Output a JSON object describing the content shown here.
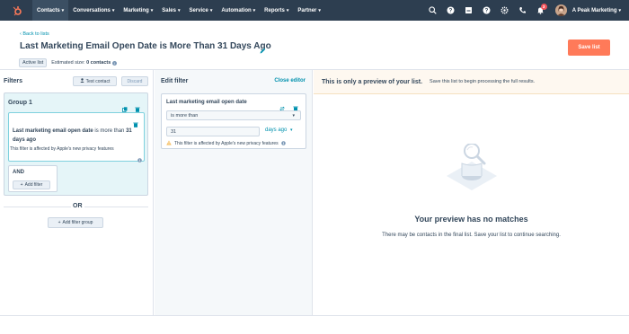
{
  "nav": {
    "items": [
      {
        "label": "Contacts",
        "active": true
      },
      {
        "label": "Conversations",
        "active": false
      },
      {
        "label": "Marketing",
        "active": false
      },
      {
        "label": "Sales",
        "active": false
      },
      {
        "label": "Service",
        "active": false
      },
      {
        "label": "Automation",
        "active": false
      },
      {
        "label": "Reports",
        "active": false
      },
      {
        "label": "Partner",
        "active": false
      }
    ],
    "notification_count": "3",
    "portal_name": "A Peak Marketing"
  },
  "header": {
    "back_link": "Back to lists",
    "title": "Last Marketing Email Open Date is More Than 31 Days Ago",
    "save_label": "Save list",
    "status_pill": "Active list",
    "estimated_prefix": "Estimated size:",
    "estimated_value": "0 contacts"
  },
  "filters_panel": {
    "title": "Filters",
    "test_contact": "Test contact",
    "discard": "Discard",
    "group_title": "Group 1",
    "filter_property": "Last marketing email open date",
    "filter_operator": "is more than",
    "filter_value": "31 days ago",
    "filter_note": "This filter is affected by Apple's new privacy features",
    "and_label": "AND",
    "add_filter": "Add filter",
    "or_label": "OR",
    "add_filter_group": "Add filter group"
  },
  "edit_filter": {
    "title": "Edit filter",
    "close_editor": "Close editor",
    "property": "Last marketing email open date",
    "operator": "is more than",
    "value": "31",
    "unit": "days ago",
    "warning": "This filter is affected by Apple's new privacy features"
  },
  "preview": {
    "banner_bold": "This is only a preview of your list.",
    "banner_text": "Save this list to begin processing the full results.",
    "empty_title": "Your preview has no matches",
    "empty_subtitle": "There may be contacts in the final list. Save your list to continue searching."
  },
  "colors": {
    "nav_bg": "#2d3e50",
    "accent_orange": "#ff7a59",
    "link_teal": "#0091ae",
    "group_bg": "#e5f5f8"
  }
}
